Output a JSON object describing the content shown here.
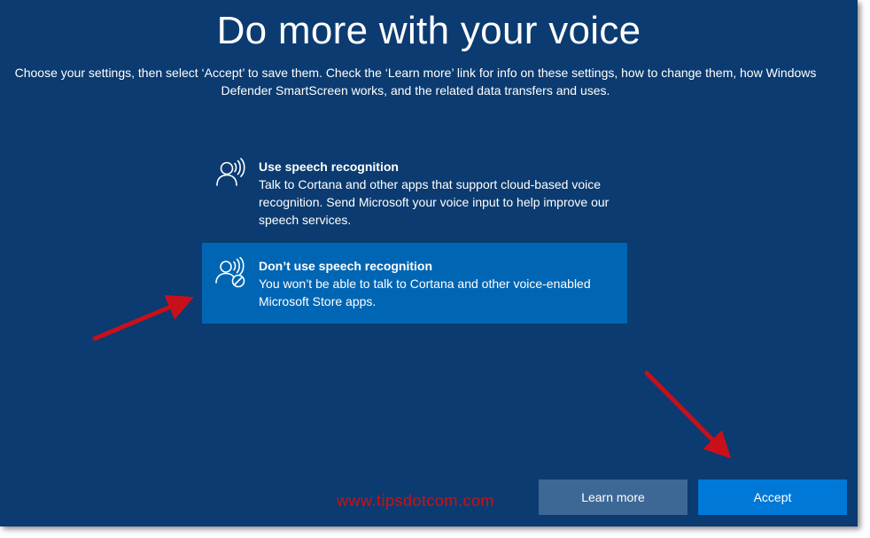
{
  "header": {
    "title": "Do more with your voice",
    "subtitle": "Choose your settings, then select ‘Accept’ to save them. Check the ‘Learn more’ link for info on these settings, how to change them, how Windows Defender SmartScreen works, and the related data transfers and uses."
  },
  "options": [
    {
      "icon": "speech-recognition-icon",
      "title": "Use speech recognition",
      "description": "Talk to Cortana and other apps that support cloud-based voice recognition. Send Microsoft your voice input to help improve our speech services.",
      "selected": false
    },
    {
      "icon": "no-speech-recognition-icon",
      "title": "Don’t use speech recognition",
      "description": "You won’t be able to talk to Cortana and other voice-enabled Microsoft Store apps.",
      "selected": true
    }
  ],
  "buttons": {
    "learn_more": "Learn more",
    "accept": "Accept"
  },
  "watermark": "www.tipsdotcom.com",
  "colors": {
    "background": "#0b3b70",
    "selected_option": "#0066b4",
    "learn_more_button": "#3d6896",
    "accept_button": "#0078d7",
    "annotation_arrow": "#c8101a"
  }
}
